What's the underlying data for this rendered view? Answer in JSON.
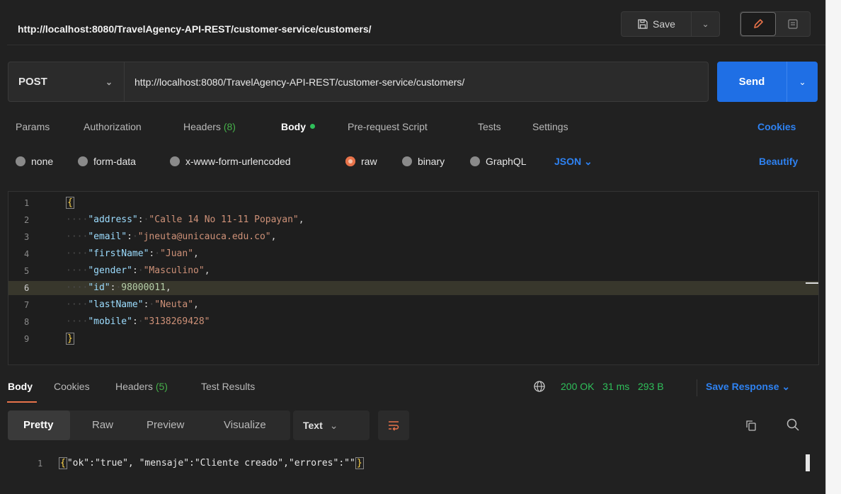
{
  "titlebar": {
    "url": "http://localhost:8080/TravelAgency-API-REST/customer-service/customers/",
    "save_label": "Save"
  },
  "request": {
    "method": "POST",
    "url": "http://localhost:8080/TravelAgency-API-REST/customer-service/customers/",
    "send_label": "Send"
  },
  "req_tabs": {
    "params": "Params",
    "authorization": "Authorization",
    "headers": "Headers",
    "headers_count": "(8)",
    "body": "Body",
    "prerequest": "Pre-request Script",
    "tests": "Tests",
    "settings": "Settings",
    "cookies": "Cookies"
  },
  "body_types": {
    "none": "none",
    "form_data": "form-data",
    "urlencoded": "x-www-form-urlencoded",
    "raw": "raw",
    "binary": "binary",
    "graphql": "GraphQL",
    "format": "JSON",
    "beautify": "Beautify"
  },
  "editor": {
    "lines": [
      {
        "n": "1"
      },
      {
        "n": "2",
        "key": "\"address\"",
        "val": "\"Calle 14 No 11-11 Popayan\""
      },
      {
        "n": "3",
        "key": "\"email\"",
        "val": "\"jneuta@unicauca.edu.co\""
      },
      {
        "n": "4",
        "key": "\"firstName\"",
        "val": "\"Juan\""
      },
      {
        "n": "5",
        "key": "\"gender\"",
        "val": "\"Masculino\""
      },
      {
        "n": "6",
        "key": "\"id\"",
        "val": "98000011"
      },
      {
        "n": "7",
        "key": "\"lastName\"",
        "val": "\"Neuta\""
      },
      {
        "n": "8",
        "key": "\"mobile\"",
        "val": "\"3138269428\""
      },
      {
        "n": "9"
      }
    ]
  },
  "response": {
    "tabs": {
      "body": "Body",
      "cookies": "Cookies",
      "headers": "Headers",
      "headers_count": "(5)",
      "test_results": "Test Results"
    },
    "status": "200 OK",
    "time": "31 ms",
    "size": "293 B",
    "save_response": "Save Response",
    "views": {
      "pretty": "Pretty",
      "raw": "Raw",
      "preview": "Preview",
      "visualize": "Visualize",
      "text": "Text"
    },
    "line_number": "1",
    "body_text": "\"ok\":\"true\", \"mensaje\":\"Cliente creado\",\"errores\":\"\""
  }
}
